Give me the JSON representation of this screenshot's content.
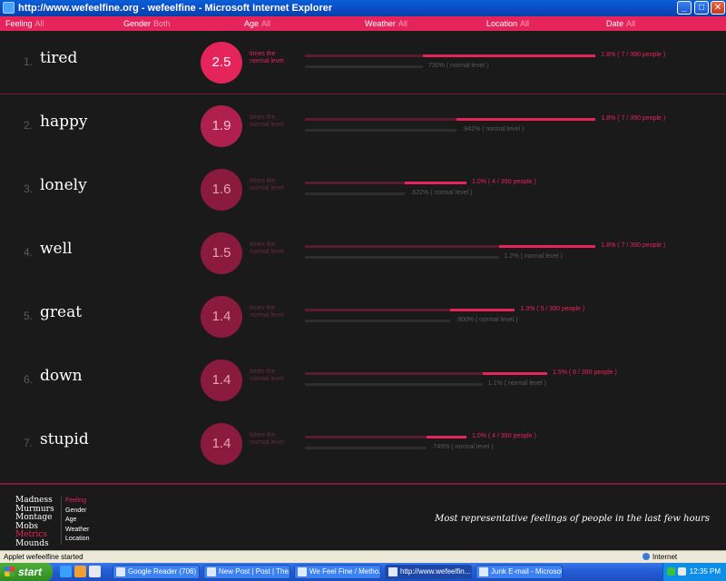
{
  "window": {
    "title": "http://www.wefeelfine.org - wefeelfine - Microsoft Internet Explorer",
    "min_label": "_",
    "max_label": "□",
    "close_label": "✕"
  },
  "filters": [
    {
      "label": "Feeling",
      "value": "All"
    },
    {
      "label": "Gender",
      "value": "Both"
    },
    {
      "label": "Age",
      "value": "All"
    },
    {
      "label": "Weather",
      "value": "All"
    },
    {
      "label": "Location",
      "value": "All"
    },
    {
      "label": "Date",
      "value": "All"
    }
  ],
  "times_label_1": "times the",
  "times_label_2": "normal level",
  "feelings": [
    {
      "rank": "1.",
      "word": "tired",
      "factor": "2.5",
      "pct": "1.8% ( 7 / 390 people )",
      "norm": "730% ( normal level )",
      "share": 0.018,
      "norm_share": 0.0073
    },
    {
      "rank": "2.",
      "word": "happy",
      "factor": "1.9",
      "pct": "1.8% ( 7 / 390 people )",
      "norm": ".942% ( normal level )",
      "share": 0.018,
      "norm_share": 0.0094
    },
    {
      "rank": "3.",
      "word": "lonely",
      "factor": "1.6",
      "pct": "1.0% ( 4 / 390 people )",
      "norm": ".622% ( normal level )",
      "share": 0.01,
      "norm_share": 0.0062
    },
    {
      "rank": "4.",
      "word": "well",
      "factor": "1.5",
      "pct": "1.8% ( 7 / 390 people )",
      "norm": "1.2% ( normal level )",
      "share": 0.018,
      "norm_share": 0.012
    },
    {
      "rank": "5.",
      "word": "great",
      "factor": "1.4",
      "pct": "1.3% ( 5 / 390 people )",
      "norm": ".900% ( normal level )",
      "share": 0.013,
      "norm_share": 0.009
    },
    {
      "rank": "6.",
      "word": "down",
      "factor": "1.4",
      "pct": "1.5% ( 6 / 390 people )",
      "norm": "1.1% ( normal level )",
      "share": 0.015,
      "norm_share": 0.011
    },
    {
      "rank": "7.",
      "word": "stupid",
      "factor": "1.4",
      "pct": "1.0% ( 4 / 390 people )",
      "norm": ".749% ( normal level )",
      "share": 0.01,
      "norm_share": 0.0075
    }
  ],
  "nav": [
    "Madness",
    "Murmurs",
    "Montage",
    "Mobs",
    "Metrics",
    "Mounds"
  ],
  "subnav": [
    "Feeling",
    "Gender",
    "Age",
    "Weather",
    "Location"
  ],
  "caption": "Most representative feelings of people in the last few hours",
  "statusbar": {
    "left": "Applet wefeelfine started",
    "right": "Internet"
  },
  "taskbar": {
    "start": "start",
    "tasks": [
      "Google Reader (706) ...",
      "New Post | Post | The...",
      "We Feel Fine / Metho...",
      "http://www.wefeelfin...",
      "Junk E-mail - Microsof..."
    ],
    "clock": "12:35 PM"
  },
  "colors": {
    "accent": "#e5245c",
    "background": "#1a1a1a"
  }
}
